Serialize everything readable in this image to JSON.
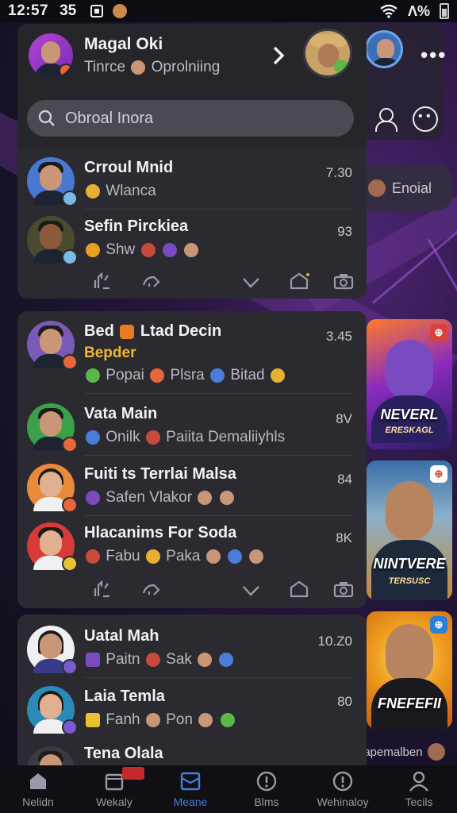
{
  "status_bar": {
    "time": "12:57",
    "number": "35",
    "signal_text": "Λ%"
  },
  "header": {
    "name": "Magal Oki",
    "subtitle": "Tinrce",
    "subtitle_tail": "Oprolniing",
    "search_placeholder": "Obroal Inora"
  },
  "background": {
    "pill_label": "Enoial",
    "bottom_label": "eapemalben",
    "posters": [
      {
        "title": "NEVERL",
        "sub": "ERESKAGL"
      },
      {
        "title": "NINTVERE",
        "sub": "TERSUSC"
      },
      {
        "title": "FNEFEFII",
        "sub": ""
      }
    ]
  },
  "chats_top": [
    {
      "name": "Crroul Mnid",
      "preview": "Wlanca",
      "time": "7.30"
    },
    {
      "name": "Sefin Pirckiea",
      "preview": "Shw",
      "time": "93"
    }
  ],
  "chats_mid": [
    {
      "name": "Bed",
      "name_tail": "Ltad Decin",
      "highlight": "Bepder",
      "preview": "Popai",
      "preview_mid": "Plsra",
      "preview_tail": "Bitad",
      "time": "3.45"
    },
    {
      "name": "Vata Main",
      "preview": "Onilk",
      "preview_tail": "Paiita Demaliiyhls",
      "time": "8V"
    },
    {
      "name": "Fuiti ts Terrlai Malsa",
      "preview": "Safen Vlakor",
      "time": "84"
    },
    {
      "name": "Hlacanims For Soda",
      "preview": "Fabu",
      "preview_tail": "Paka",
      "time": "8K"
    }
  ],
  "chats_bottom": [
    {
      "name": "Uatal Mah",
      "preview": "Paitn",
      "preview_tail": "Sak",
      "time": "10.Z0"
    },
    {
      "name": "Laia Temla",
      "preview": "Fanh",
      "preview_tail": "Pon",
      "time": "80"
    },
    {
      "name": "Tena Olala",
      "preview": "",
      "time": ""
    }
  ],
  "bottom_nav": [
    {
      "label": "Nelidn",
      "icon": "home-icon"
    },
    {
      "label": "Wekaly",
      "icon": "calendar-icon",
      "badge": ""
    },
    {
      "label": "Meane",
      "icon": "inbox-icon",
      "active": true
    },
    {
      "label": "Blms",
      "icon": "info-icon"
    },
    {
      "label": "Wehinaloy",
      "icon": "info-icon"
    },
    {
      "label": "Tecils",
      "icon": "profile-icon"
    }
  ],
  "colors": {
    "accent": "#4a7dd8",
    "highlight": "#f0b830",
    "badge_red": "#c52a2a",
    "panel": "#2a2a30"
  }
}
